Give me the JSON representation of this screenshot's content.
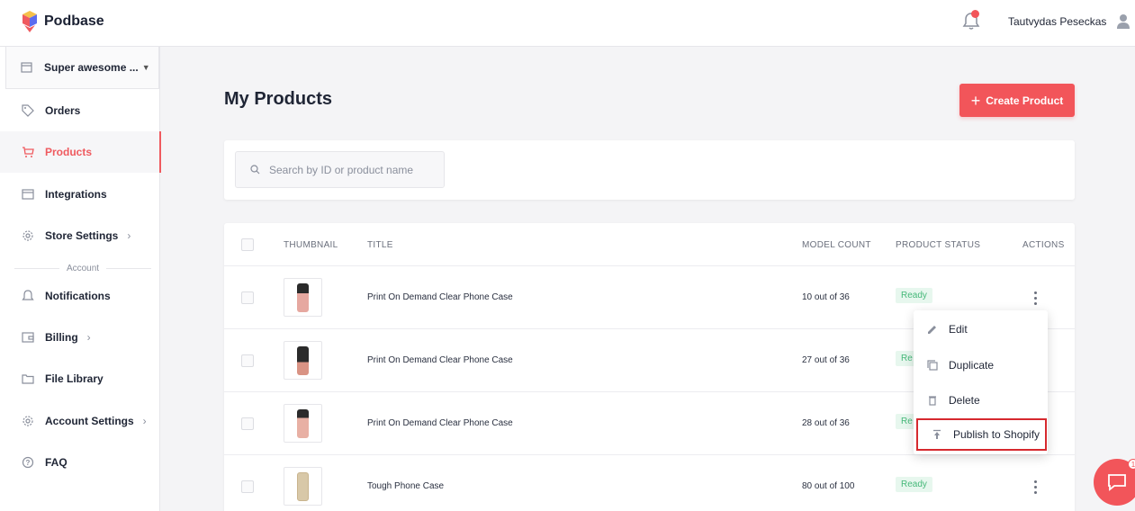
{
  "header": {
    "app_name": "Podbase",
    "user_name": "Tautvydas Peseckas",
    "colors": {
      "brand": "#f2555a",
      "notification_dot": "#f2555a"
    }
  },
  "sidebar": {
    "store_name": "Super awesome ...",
    "items": [
      {
        "label": "Orders",
        "icon": "tag-icon"
      },
      {
        "label": "Products",
        "icon": "cart-icon",
        "active": true
      },
      {
        "label": "Integrations",
        "icon": "store-icon"
      },
      {
        "label": "Store Settings",
        "icon": "gear-icon"
      },
      {
        "label": "Notifications",
        "icon": "bell-icon"
      },
      {
        "label": "Billing",
        "icon": "wallet-icon"
      },
      {
        "label": "File Library",
        "icon": "folder-icon"
      },
      {
        "label": "Account Settings",
        "icon": "gear-icon"
      },
      {
        "label": "FAQ",
        "icon": "question-icon"
      }
    ],
    "section_label": "Account"
  },
  "main": {
    "title": "My Products",
    "create_button": "Create Product",
    "search_placeholder": "Search by ID or product name",
    "table": {
      "columns": [
        "THUMBNAIL",
        "TITLE",
        "MODEL COUNT",
        "PRODUCT STATUS",
        "ACTIONS"
      ],
      "rows": [
        {
          "title": "Print On Demand Clear Phone Case",
          "model_count": "10 out of 36",
          "status": "Ready"
        },
        {
          "title": "Print On Demand Clear Phone Case",
          "model_count": "27 out of 36",
          "status": "Re"
        },
        {
          "title": "Print On Demand Clear Phone Case",
          "model_count": "28 out of 36",
          "status": "Re"
        },
        {
          "title": "Tough Phone Case",
          "model_count": "80 out of 100",
          "status": "Ready"
        }
      ]
    },
    "actions_menu": {
      "items": [
        "Edit",
        "Duplicate",
        "Delete",
        "Publish to Shopify"
      ],
      "highlighted": "Publish to Shopify"
    }
  },
  "chat": {
    "count": "1"
  }
}
